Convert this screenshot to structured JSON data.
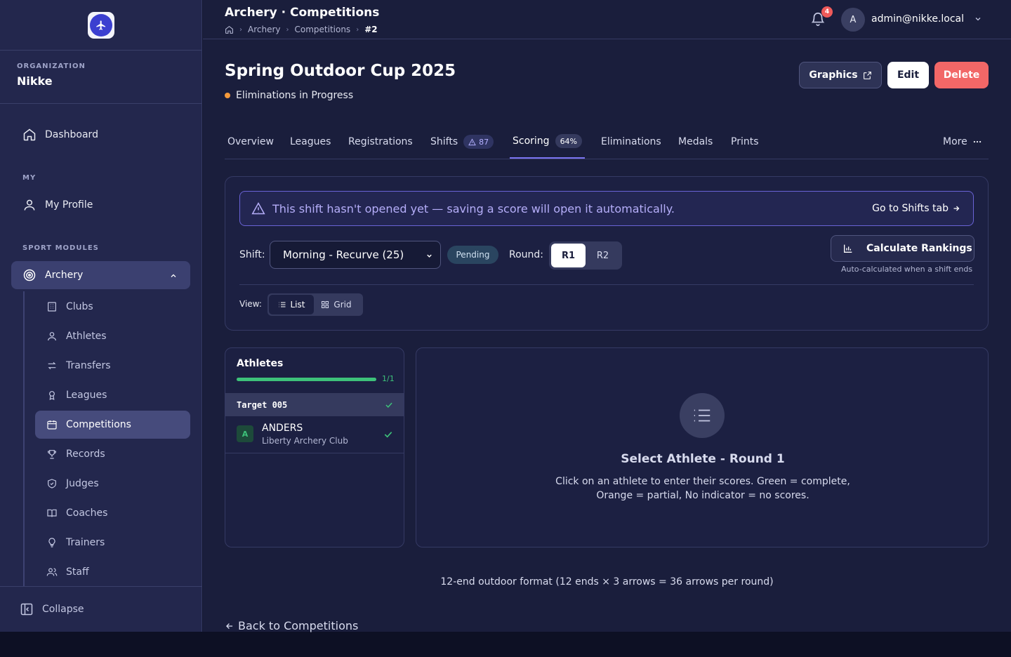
{
  "sidebar": {
    "org_label": "ORGANIZATION",
    "org_name": "Nikke",
    "dashboard": "Dashboard",
    "my_label": "MY",
    "my_profile": "My Profile",
    "sport_modules_label": "SPORT MODULES",
    "archery": "Archery",
    "sub_items": [
      "Clubs",
      "Athletes",
      "Transfers",
      "Leagues",
      "Competitions",
      "Records",
      "Judges",
      "Coaches",
      "Trainers",
      "Staff"
    ],
    "active_item": "Competitions",
    "collapse": "Collapse"
  },
  "header": {
    "title": "Archery · Competitions",
    "breadcrumbs": [
      "Archery",
      "Competitions",
      "#2"
    ],
    "notification_count": "4",
    "avatar_initial": "A",
    "user_email": "admin@nikke.local"
  },
  "competition": {
    "name": "Spring Outdoor Cup 2025",
    "status": "Eliminations in Progress",
    "status_color": "#f59a3b",
    "actions": {
      "graphics": "Graphics",
      "edit": "Edit",
      "delete": "Delete"
    }
  },
  "tabs": {
    "overview": "Overview",
    "leagues": "Leagues",
    "registrations": "Registrations",
    "shifts": "Shifts",
    "shifts_warning_count": "87",
    "scoring": "Scoring",
    "scoring_progress": "64%",
    "eliminations": "Eliminations",
    "medals": "Medals",
    "prints": "Prints",
    "more": "More",
    "active": "Scoring"
  },
  "scoring": {
    "alert_text": "This shift hasn't opened yet — saving a score will open it automatically.",
    "alert_link": "Go to Shifts tab",
    "shift_label": "Shift:",
    "shift_value": "Morning - Recurve (25)",
    "shift_status": "Pending",
    "round_label": "Round:",
    "rounds": [
      "R1",
      "R2"
    ],
    "selected_round": "R1",
    "calc_button": "Calculate Rankings",
    "calc_note": "Auto-calculated when a shift ends",
    "view_label": "View:",
    "view_options": [
      "List",
      "Grid"
    ],
    "selected_view": "List"
  },
  "athletes_panel": {
    "title": "Athletes",
    "progress_text": "1/1",
    "progress_fraction": 1.0,
    "target_label": "Target 005",
    "athletes": [
      {
        "initial": "A",
        "name": "ANDERS",
        "club": "Liberty Archery Club",
        "status": "complete"
      }
    ]
  },
  "detail_panel": {
    "title": "Select Athlete - Round 1",
    "text_line1": "Click on an athlete to enter their scores. Green = complete,",
    "text_line2": "Orange = partial, No indicator = no scores."
  },
  "footer": {
    "format_note": "12-end outdoor format (12 ends × 3 arrows = 36 arrows per round)",
    "back_link": "Back to Competitions"
  },
  "colors": {
    "accent": "#7b74f0",
    "success": "#3dc27a",
    "danger": "#f26767"
  }
}
